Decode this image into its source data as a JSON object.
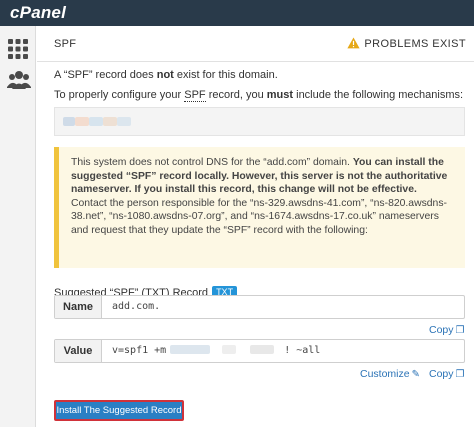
{
  "app": {
    "logo": "cPanel"
  },
  "header": {
    "title": "SPF",
    "status": "PROBLEMS EXIST"
  },
  "intro": {
    "line1_pre": "A “SPF” record does ",
    "line1_bold": "not",
    "line1_post": " exist for this domain.",
    "line2_pre": "To properly configure your ",
    "line2_spf": "SPF",
    "line2_mid": " record, you ",
    "line2_bold": "must",
    "line2_post": " include the following mechanisms:"
  },
  "notice": {
    "t1": "This system does not control DNS for the “add.com” domain. ",
    "t2": "You can install the suggested “SPF” record locally. However, this server is not the authoritative nameserver. If you install this record, this change will not be effective.",
    "t3": " Contact the person responsible for the “ns-329.awsdns-41.com”, “ns-820.awsdns-38.net”, “ns-1080.awsdns-07.org”, and “ns-1674.awsdns-17.co.uk” nameservers and request that they update the “SPF” record with the following:"
  },
  "suggested": {
    "label": "Suggested “SPF” (TXT) Record",
    "badge": "TXT"
  },
  "name_field": {
    "label": "Name",
    "value": "add.com."
  },
  "value_field": {
    "label": "Value",
    "value_start": "v=spf1 +m",
    "value_end": "! ~all"
  },
  "links": {
    "copy": "Copy",
    "customize": "Customize"
  },
  "install_button": {
    "label": "Install The Suggested Record"
  },
  "colors": {
    "topbar": "#293a4a",
    "accent": "#2b73b6",
    "warning": "#f0c33c",
    "badge": "#2494d8",
    "highlight": "#d0323a"
  }
}
